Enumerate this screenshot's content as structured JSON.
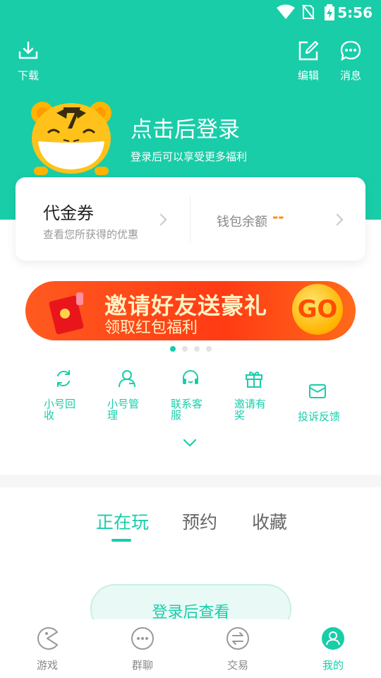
{
  "status_bar": {
    "time": "5:56",
    "icons": [
      "wifi-icon",
      "no-sim-icon",
      "battery-charging-icon"
    ]
  },
  "header": {
    "download_label": "下载",
    "edit_label": "编辑",
    "messages_label": "消息",
    "login_title": "点击后登录",
    "login_subtitle": "登录后可以享受更多福利"
  },
  "wallet_card": {
    "coupon_title": "代金券",
    "coupon_subtitle": "查看您所获得的优惠",
    "wallet_label": "钱包余额",
    "wallet_value": "--"
  },
  "banner": {
    "title": "邀请好友送豪礼",
    "subtitle": "领取红包福利",
    "go_label": "GO",
    "page_count": 4,
    "active_page": 1
  },
  "quick_actions": [
    {
      "label": "小号回收",
      "icon": "recycle-icon"
    },
    {
      "label": "小号管理",
      "icon": "account-manage-icon"
    },
    {
      "label": "联系客服",
      "icon": "headset-icon"
    },
    {
      "label": "邀请有奖",
      "icon": "gift-icon"
    },
    {
      "label": "投诉反馈",
      "icon": "mail-icon"
    }
  ],
  "tabs": {
    "playing": "正在玩",
    "reserved": "预约",
    "favorites": "收藏",
    "active": "正在玩"
  },
  "login_view_button": "登录后查看",
  "bottom_nav": [
    {
      "label": "游戏",
      "icon": "pacman-icon"
    },
    {
      "label": "群聊",
      "icon": "chat-dots-icon"
    },
    {
      "label": "交易",
      "icon": "exchange-icon"
    },
    {
      "label": "我的",
      "icon": "profile-icon",
      "active": true
    }
  ],
  "colors": {
    "accent": "#19cda9",
    "wallet_value": "#ff8a00",
    "banner": "#ff3b14"
  }
}
